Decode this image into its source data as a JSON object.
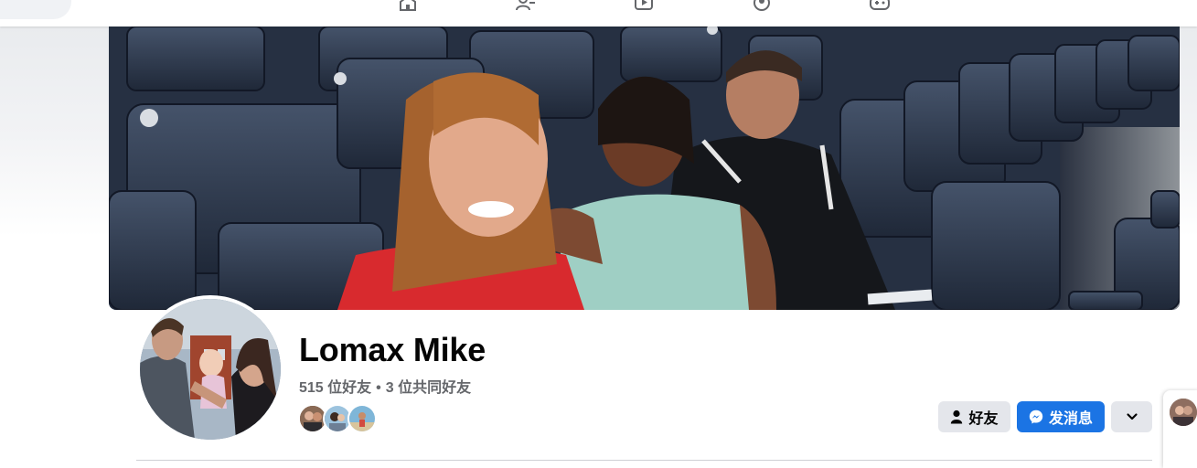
{
  "nav": {
    "icons": [
      "home-icon",
      "friends-icon",
      "watch-icon",
      "groups-icon",
      "gaming-icon"
    ]
  },
  "profile": {
    "name": "Lomax Mike",
    "friend_count": "515 位好友",
    "separator": "•",
    "mutual_friends": "3 位共同好友"
  },
  "actions": {
    "friends_label": "好友",
    "message_label": "发消息"
  },
  "colors": {
    "primary_blue": "#1b74e4",
    "secondary_button": "#e4e6eb",
    "text_primary": "#050505",
    "text_secondary": "#65676b"
  }
}
